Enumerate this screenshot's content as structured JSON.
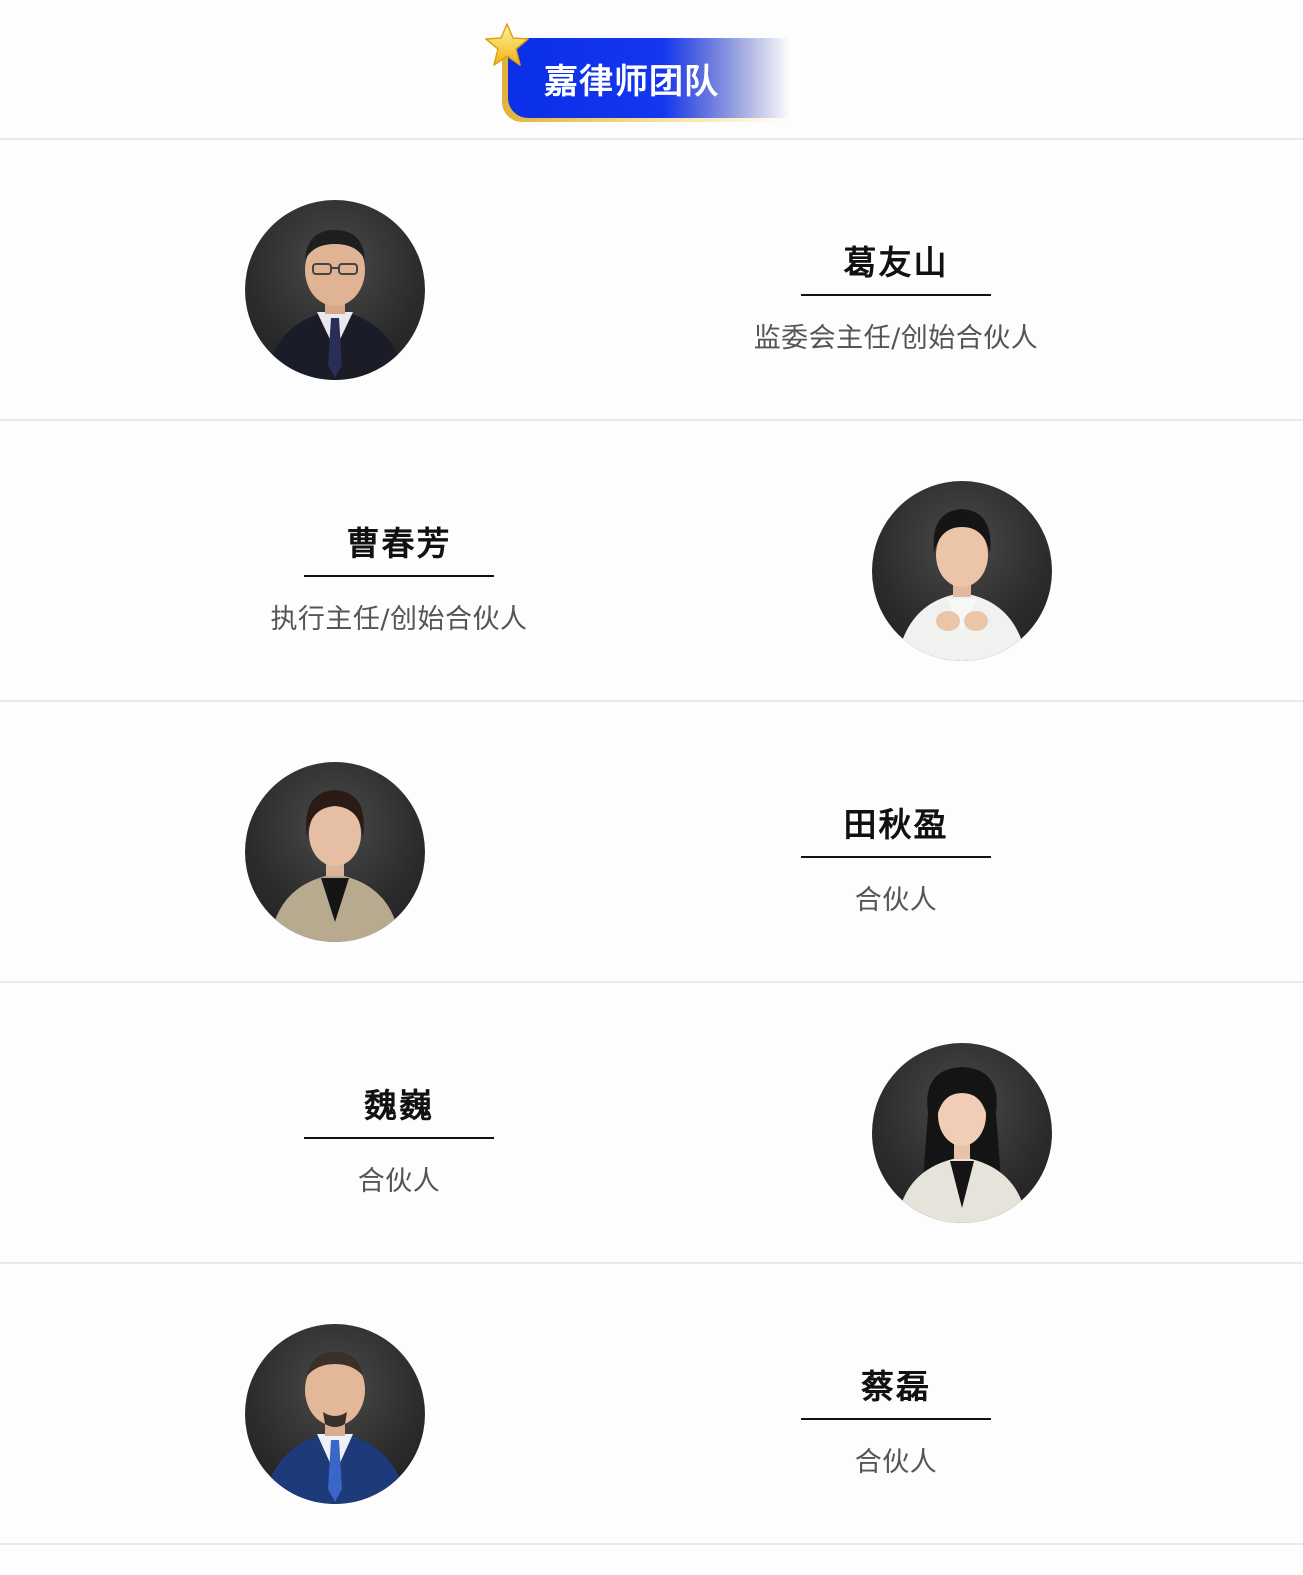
{
  "header": {
    "title": "嘉律师团队",
    "icon": "star-icon"
  },
  "members": [
    {
      "name": "葛友山",
      "role": "监委会主任/创始合伙人",
      "avatar": "portrait-man-glasses",
      "jacket": "#1a1c28",
      "shirt": "#e8e8ee",
      "tie": "#2a2d55"
    },
    {
      "name": "曹春芳",
      "role": "执行主任/创始合伙人",
      "avatar": "portrait-woman-white-blazer",
      "jacket": "#f1f1ef",
      "shirt": "#f7f7f5",
      "tie": ""
    },
    {
      "name": "田秋盈",
      "role": "合伙人",
      "avatar": "portrait-woman-beige-blazer",
      "jacket": "#b7aa8e",
      "shirt": "#151515",
      "tie": ""
    },
    {
      "name": "魏巍",
      "role": "合伙人",
      "avatar": "portrait-woman-long-hair",
      "jacket": "#e6e3db",
      "shirt": "#141414",
      "tie": ""
    },
    {
      "name": "蔡磊",
      "role": "合伙人",
      "avatar": "portrait-man-blue-suit",
      "jacket": "#1d3a7a",
      "shirt": "#eef0f5",
      "tie": "#3a66c8"
    }
  ]
}
